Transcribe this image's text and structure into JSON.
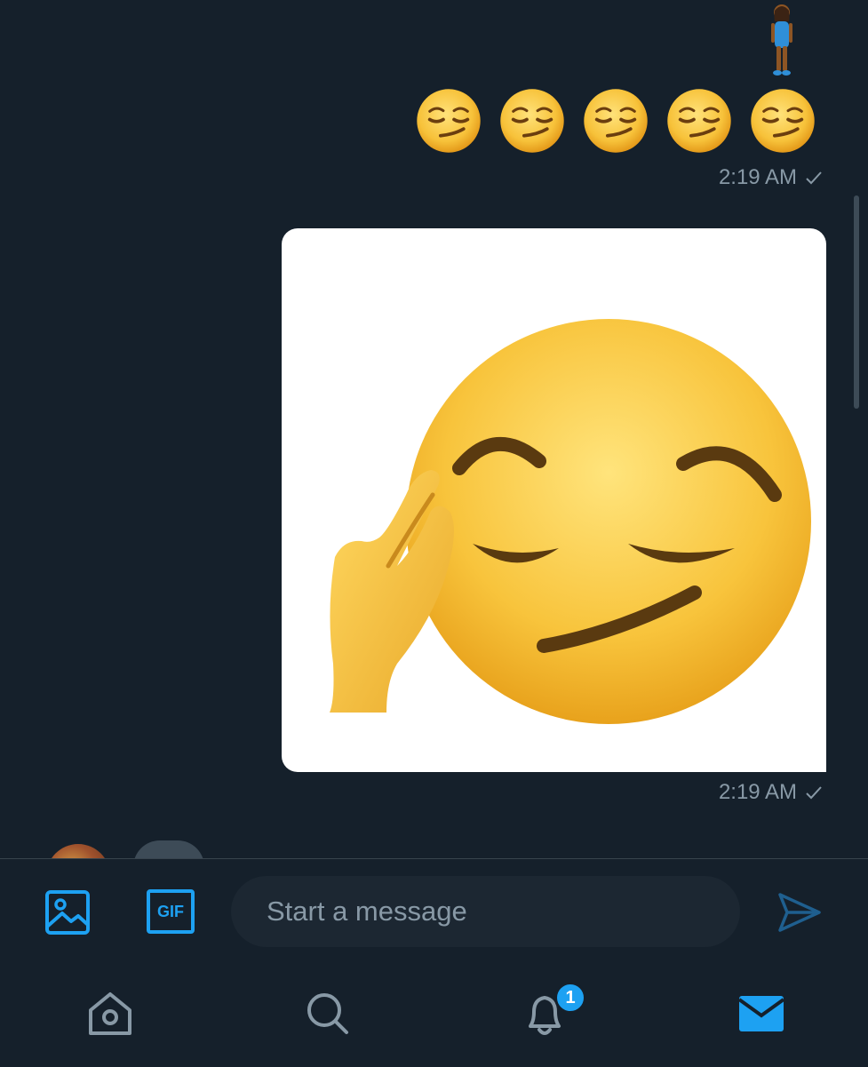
{
  "messages": [
    {
      "type": "emoji",
      "emojis": [
        "person-standing-emoji",
        "smirk-emoji",
        "smirk-emoji",
        "smirk-emoji",
        "smirk-emoji",
        "smirk-emoji"
      ],
      "time": "2:19 AM"
    },
    {
      "type": "image",
      "image": "saluting-smirk-emoji",
      "time": "2:19 AM"
    }
  ],
  "composer": {
    "placeholder": "Start a message",
    "gif_label": "GIF",
    "media_icon": "image-icon",
    "send_icon": "send-icon"
  },
  "nav": {
    "items": [
      {
        "name": "home",
        "icon": "home-icon"
      },
      {
        "name": "search",
        "icon": "search-icon"
      },
      {
        "name": "notifications",
        "icon": "bell-icon",
        "badge": "1"
      },
      {
        "name": "messages",
        "icon": "envelope-icon"
      }
    ]
  },
  "colors": {
    "background": "#15202b",
    "accent": "#1da1f2",
    "muted_text": "#8899a6",
    "input_bg": "#1c2732"
  }
}
